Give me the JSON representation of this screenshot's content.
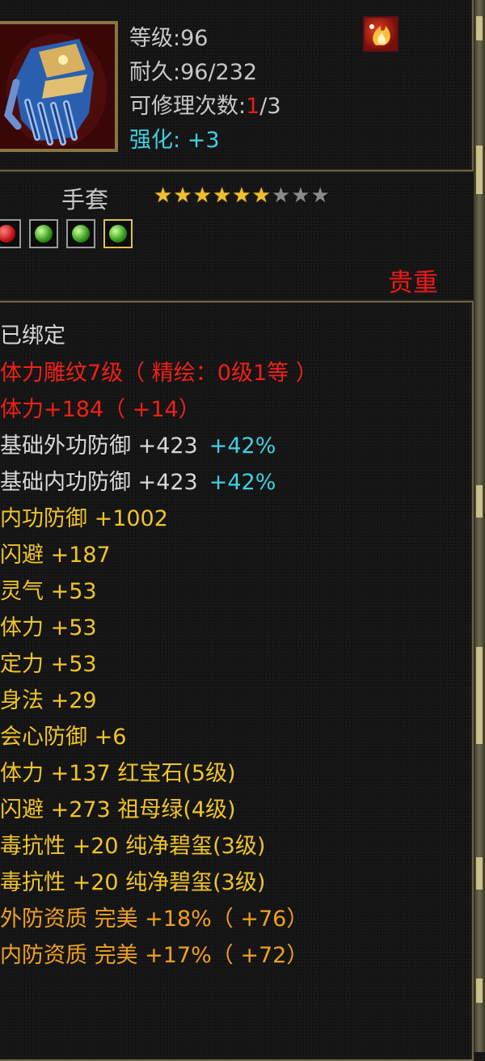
{
  "item": {
    "level_text": "等级:96",
    "durability_text": "耐久:96/232",
    "repair_label": "可修理次数:",
    "repair_current": "1",
    "repair_rest": "/3",
    "enhance_label": "强化:",
    "enhance_value": "+3",
    "name": "手套",
    "stars_filled": 6,
    "stars_total": 9,
    "rarity": "贵重",
    "colors": {
      "red": "#f02018",
      "gold": "#f0c428",
      "cyan": "#3fd0e0",
      "white": "#d8d8d8",
      "orange": "#f0a020"
    },
    "icons": {
      "portrait": "gauntlet-icon",
      "corner": "flame-buff-icon"
    },
    "gems": [
      "red-gem-icon",
      "green-gem-icon",
      "green-gem-icon",
      "green-gem-icon"
    ]
  },
  "attributes": [
    {
      "text": "已绑定",
      "color": "white"
    },
    {
      "text": "体力雕纹7级（ 精绘：0级1等 ）",
      "color": "red"
    },
    {
      "text": "体力+184（ +14）",
      "color": "red"
    },
    {
      "text": "基础外功防御 +423",
      "extra": "+42%",
      "color": "white"
    },
    {
      "text": "基础内功防御 +423",
      "extra": "+42%",
      "color": "white"
    },
    {
      "text": "内功防御 +1002",
      "color": "gold"
    },
    {
      "text": "闪避 +187",
      "color": "gold"
    },
    {
      "text": "灵气 +53",
      "color": "gold"
    },
    {
      "text": "体力 +53",
      "color": "gold"
    },
    {
      "text": "定力 +53",
      "color": "gold"
    },
    {
      "text": "身法 +29",
      "color": "gold"
    },
    {
      "text": "会心防御 +6",
      "color": "gold"
    },
    {
      "text": "体力 +137 红宝石(5级)",
      "color": "gold"
    },
    {
      "text": "闪避 +273 祖母绿(4级)",
      "color": "gold"
    },
    {
      "text": "毒抗性 +20 纯净碧玺(3级)",
      "color": "gold"
    },
    {
      "text": "毒抗性 +20 纯净碧玺(3级)",
      "color": "gold"
    },
    {
      "text": "外防资质 完美 +18%（ +76）",
      "color": "orange"
    },
    {
      "text": "内防资质 完美 +17%（ +72）",
      "color": "orange"
    }
  ]
}
